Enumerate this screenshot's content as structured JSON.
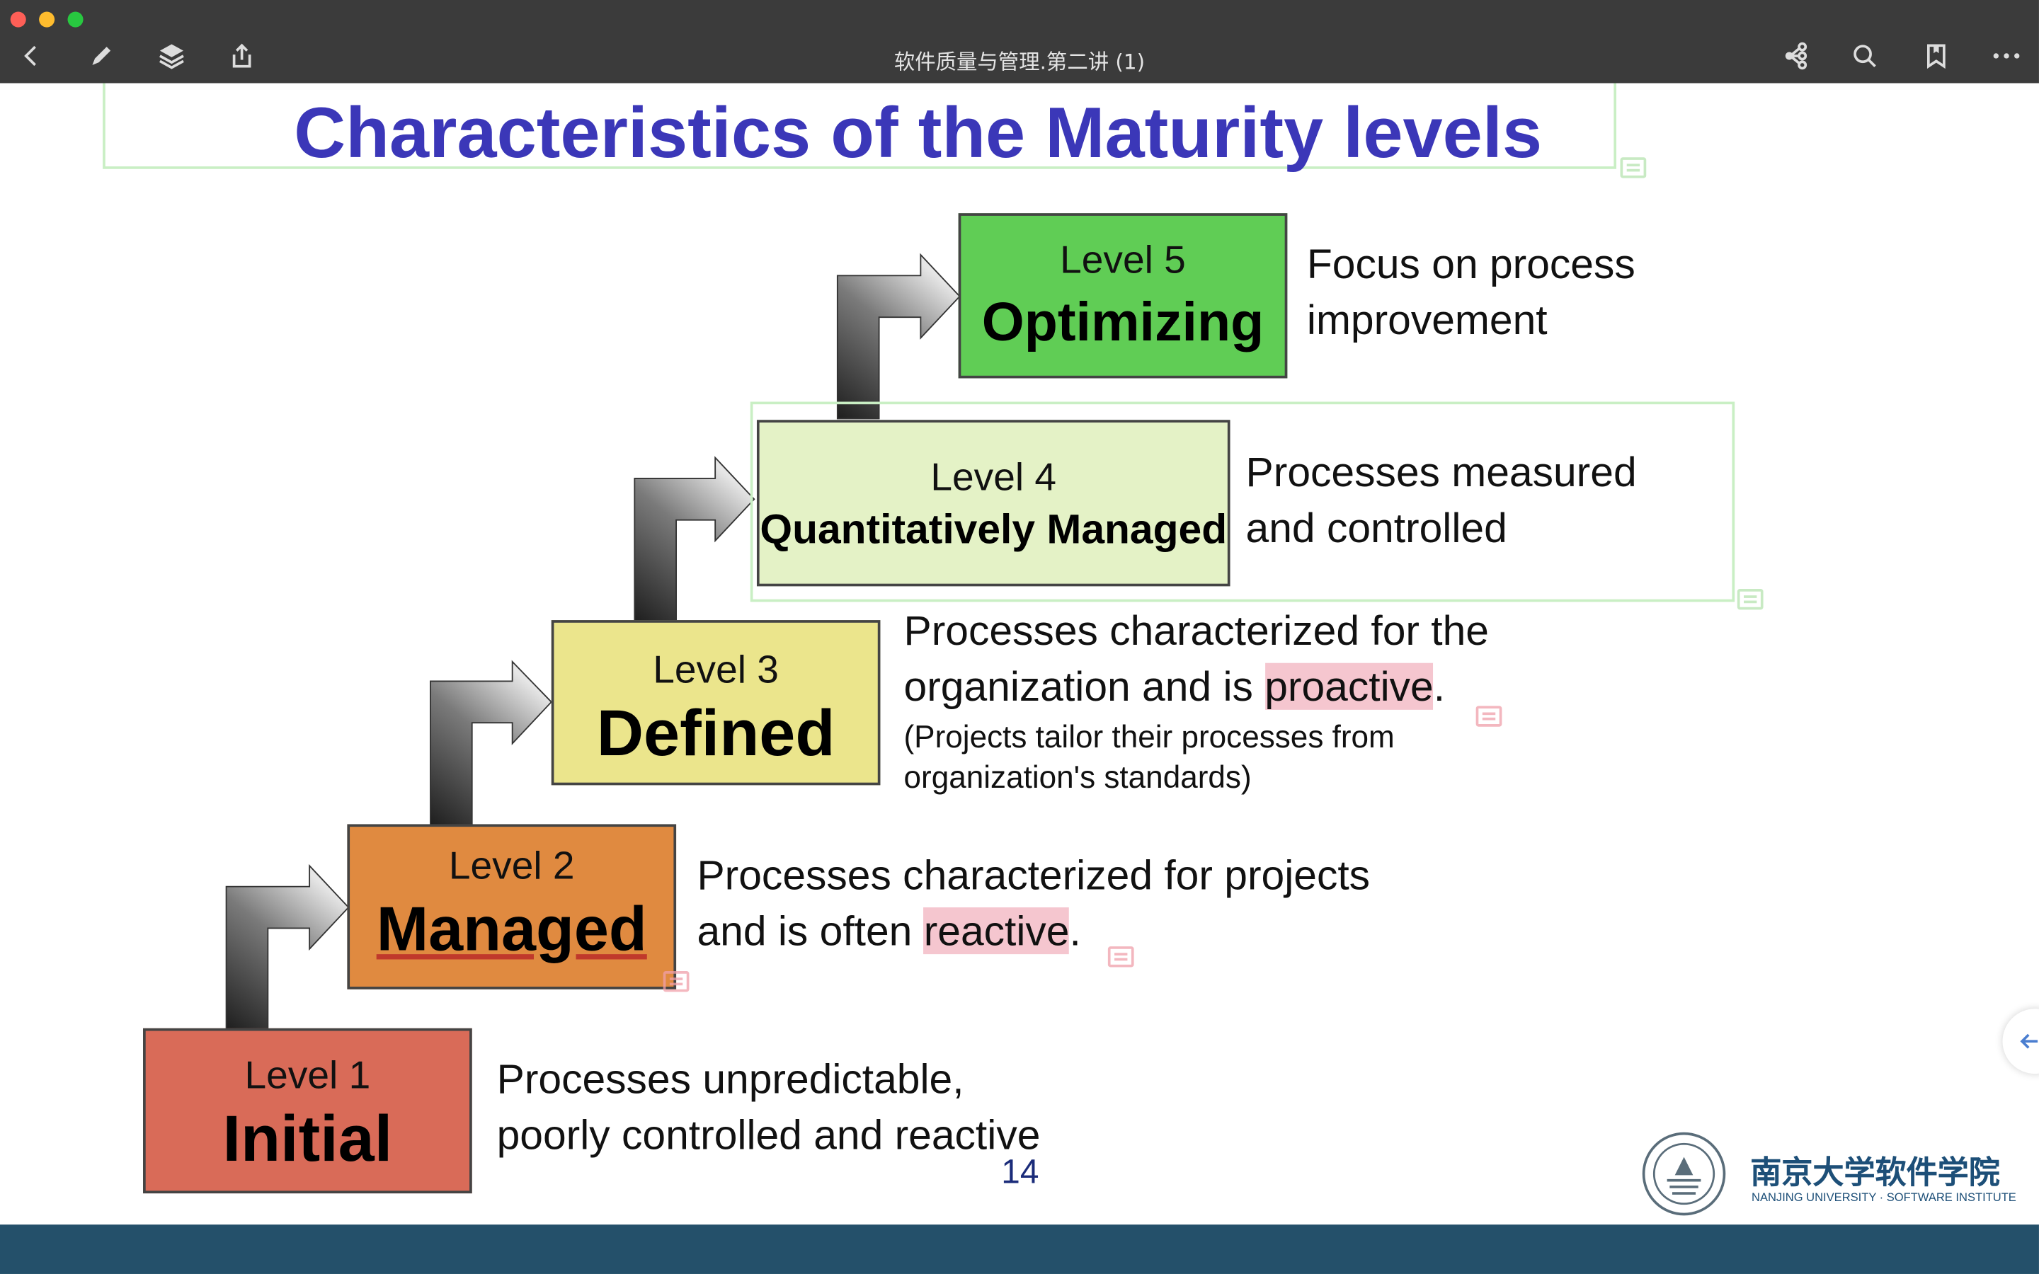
{
  "window": {
    "title": "软件质量与管理.第二讲 (1)"
  },
  "toolbar": {
    "left": [
      "back-icon",
      "pencil-icon",
      "layers-icon",
      "share-icon"
    ],
    "right": [
      "mindmap-icon",
      "search-icon",
      "bookmark-icon",
      "more-icon"
    ]
  },
  "slide": {
    "title": "Characteristics of the Maturity levels",
    "page_number": "14",
    "logo": {
      "name_cn": "南京大学软件学院",
      "name_en": "NANJING UNIVERSITY · SOFTWARE INSTITUTE"
    },
    "levels": [
      {
        "number_label": "Level 1",
        "name": "Initial",
        "color": "#d96b58",
        "description_line1": "Processes unpredictable,",
        "description_line2": "poorly controlled and reactive"
      },
      {
        "number_label": "Level 2",
        "name": "Managed",
        "color": "#e08a40",
        "description_line1": "Processes characterized for projects",
        "description_line2_prefix": "and is often ",
        "highlight": "reactive",
        "description_line2_suffix": "."
      },
      {
        "number_label": "Level 3",
        "name": "Defined",
        "color": "#ebe58c",
        "description_line1": "Processes characterized for the",
        "description_line2_prefix": "organization and is ",
        "highlight": "proactive",
        "description_line2_suffix": ".",
        "note_line1": "(Projects tailor their processes from",
        "note_line2": "organization's standards)"
      },
      {
        "number_label": "Level 4",
        "name": "Quantitatively Managed",
        "color": "#e4f2c6",
        "description_line1": "Processes measured",
        "description_line2": "and controlled"
      },
      {
        "number_label": "Level 5",
        "name": "Optimizing",
        "color": "#60cd55",
        "description_line1": "Focus on process",
        "description_line2": "improvement"
      }
    ]
  },
  "colors": {
    "title": "#3b37b8",
    "highlight": "#f5c6cf",
    "annotation_frame": "#c9efc4",
    "bottom_bar": "#24506a"
  }
}
